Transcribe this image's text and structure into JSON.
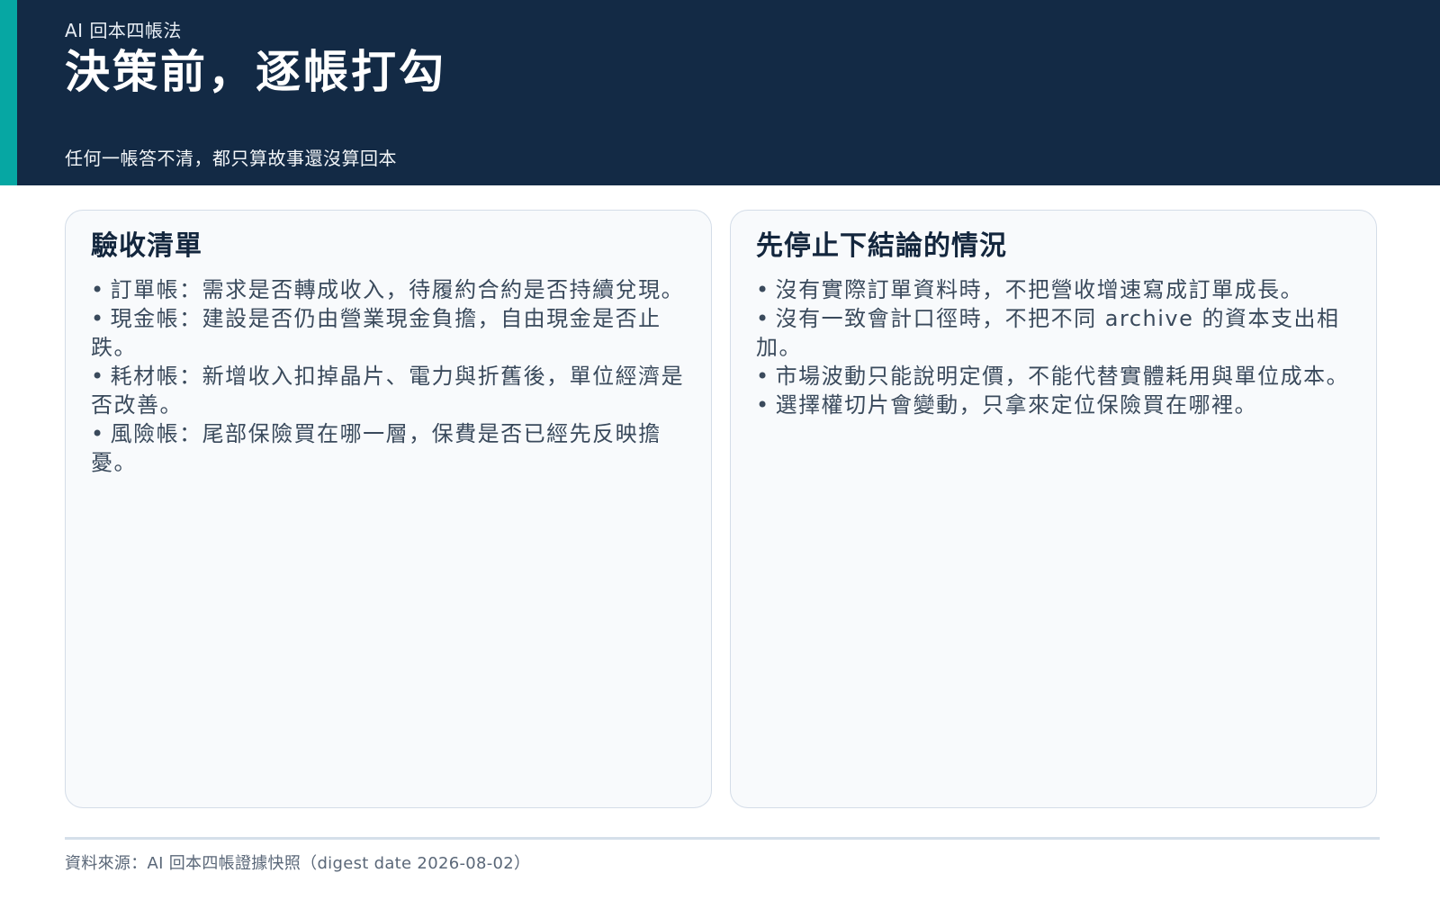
{
  "header": {
    "eyebrow": "AI 回本四帳法",
    "title": "決策前，逐帳打勾",
    "subtitle": "任何一帳答不清，都只算故事還沒算回本"
  },
  "cards": [
    {
      "heading": "驗收清單",
      "items": [
        "訂單帳：需求是否轉成收入，待履約合約是否持續兌現。",
        "現金帳：建設是否仍由營業現金負擔，自由現金是否止跌。",
        "耗材帳：新增收入扣掉晶片、電力與折舊後，單位經濟是否改善。",
        "風險帳：尾部保險買在哪一層，保費是否已經先反映擔憂。"
      ]
    },
    {
      "heading": "先停止下結論的情況",
      "items": [
        "沒有實際訂單資料時，不把營收增速寫成訂單成長。",
        "沒有一致會計口徑時，不把不同 archive 的資本支出相加。",
        "市場波動只能說明定價，不能代替實體耗用與單位成本。",
        "選擇權切片會變動，只拿來定位保險買在哪裡。"
      ]
    }
  ],
  "footer": {
    "source": "資料來源：AI 回本四帳證據快照（digest date 2026-08-02）"
  },
  "colors": {
    "header_bg": "#132a45",
    "accent": "#06a7a3",
    "card_bg": "#f8fafc",
    "card_border": "#d4dde8"
  }
}
